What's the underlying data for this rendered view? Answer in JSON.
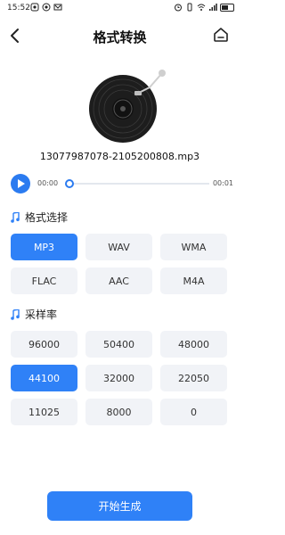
{
  "status_bar": {
    "time": "15:52",
    "icons_left": [
      "notification-icon",
      "notification-icon",
      "notification-icon"
    ],
    "icons_right": [
      "alarm-icon",
      "vibrate-icon",
      "wifi-icon",
      "signal-icon",
      "battery-icon"
    ]
  },
  "header": {
    "title": "格式转换"
  },
  "file": {
    "name": "13077987078-2105200808.mp3"
  },
  "player": {
    "current_time": "00:00",
    "total_time": "00:01",
    "progress": 0
  },
  "format_section": {
    "label": "格式选择",
    "options": [
      "MP3",
      "WAV",
      "WMA",
      "FLAC",
      "AAC",
      "M4A"
    ],
    "selected": "MP3"
  },
  "sample_rate_section": {
    "label": "采样率",
    "options": [
      "96000",
      "50400",
      "48000",
      "44100",
      "32000",
      "22050",
      "11025",
      "8000",
      "0"
    ],
    "selected": "44100"
  },
  "start_button": {
    "label": "开始生成"
  },
  "colors": {
    "accent": "#2f81f7",
    "option_bg": "#f1f3f7"
  }
}
